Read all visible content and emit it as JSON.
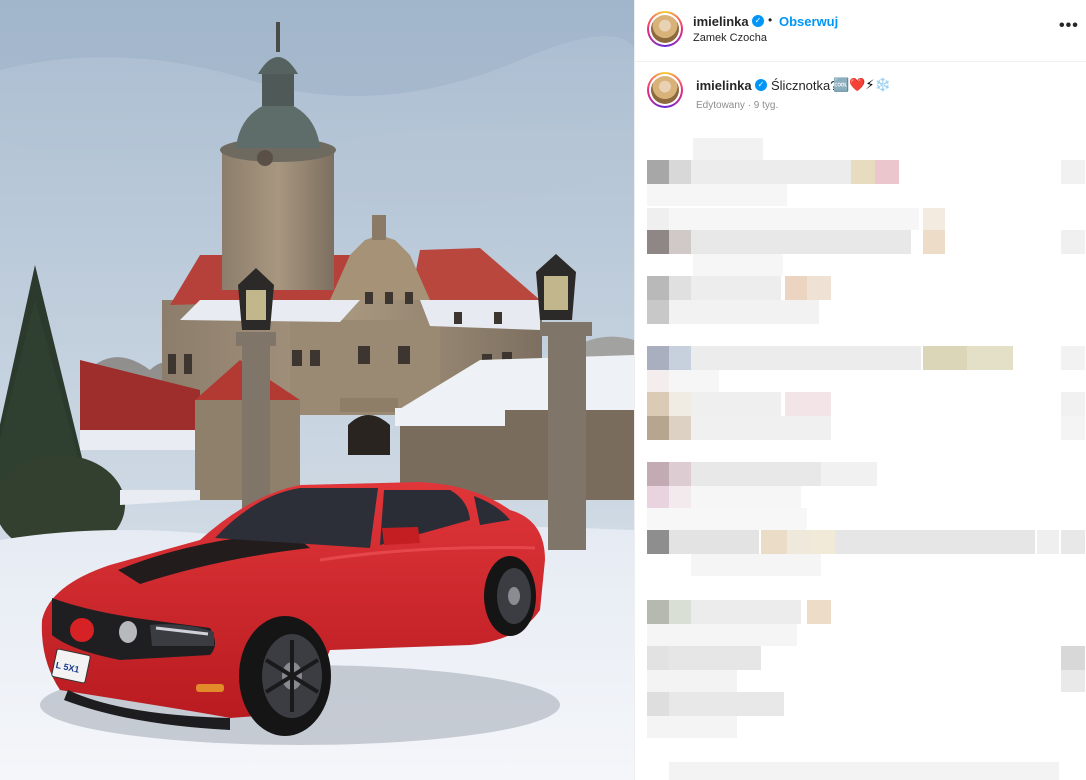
{
  "post": {
    "username": "imielinka",
    "separator": "•",
    "follow_label": "Obserwuj",
    "location": "Zamek Czocha",
    "more_label": "•••"
  },
  "caption": {
    "username": "imielinka",
    "text": "Ślicznotka?",
    "emojis": "🆒❤️⚡❄️",
    "meta": "Edytowany · 9 tyg."
  },
  "photo": {
    "plate_text": "L 5X1"
  },
  "colors": {
    "accent": "#0095f6",
    "text": "#262626",
    "muted": "#8e8e8e",
    "car": "#d8262a"
  }
}
